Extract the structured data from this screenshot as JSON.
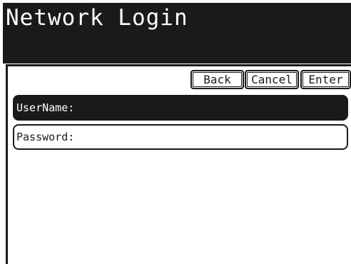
{
  "header": {
    "title": "Network Login"
  },
  "toolbar": {
    "back_label": "Back",
    "cancel_label": "Cancel",
    "enter_label": "Enter"
  },
  "form": {
    "username_label": "UserName:",
    "password_label": "Password:"
  },
  "colors": {
    "dark": "#1a1a1a",
    "light": "#ffffff"
  }
}
